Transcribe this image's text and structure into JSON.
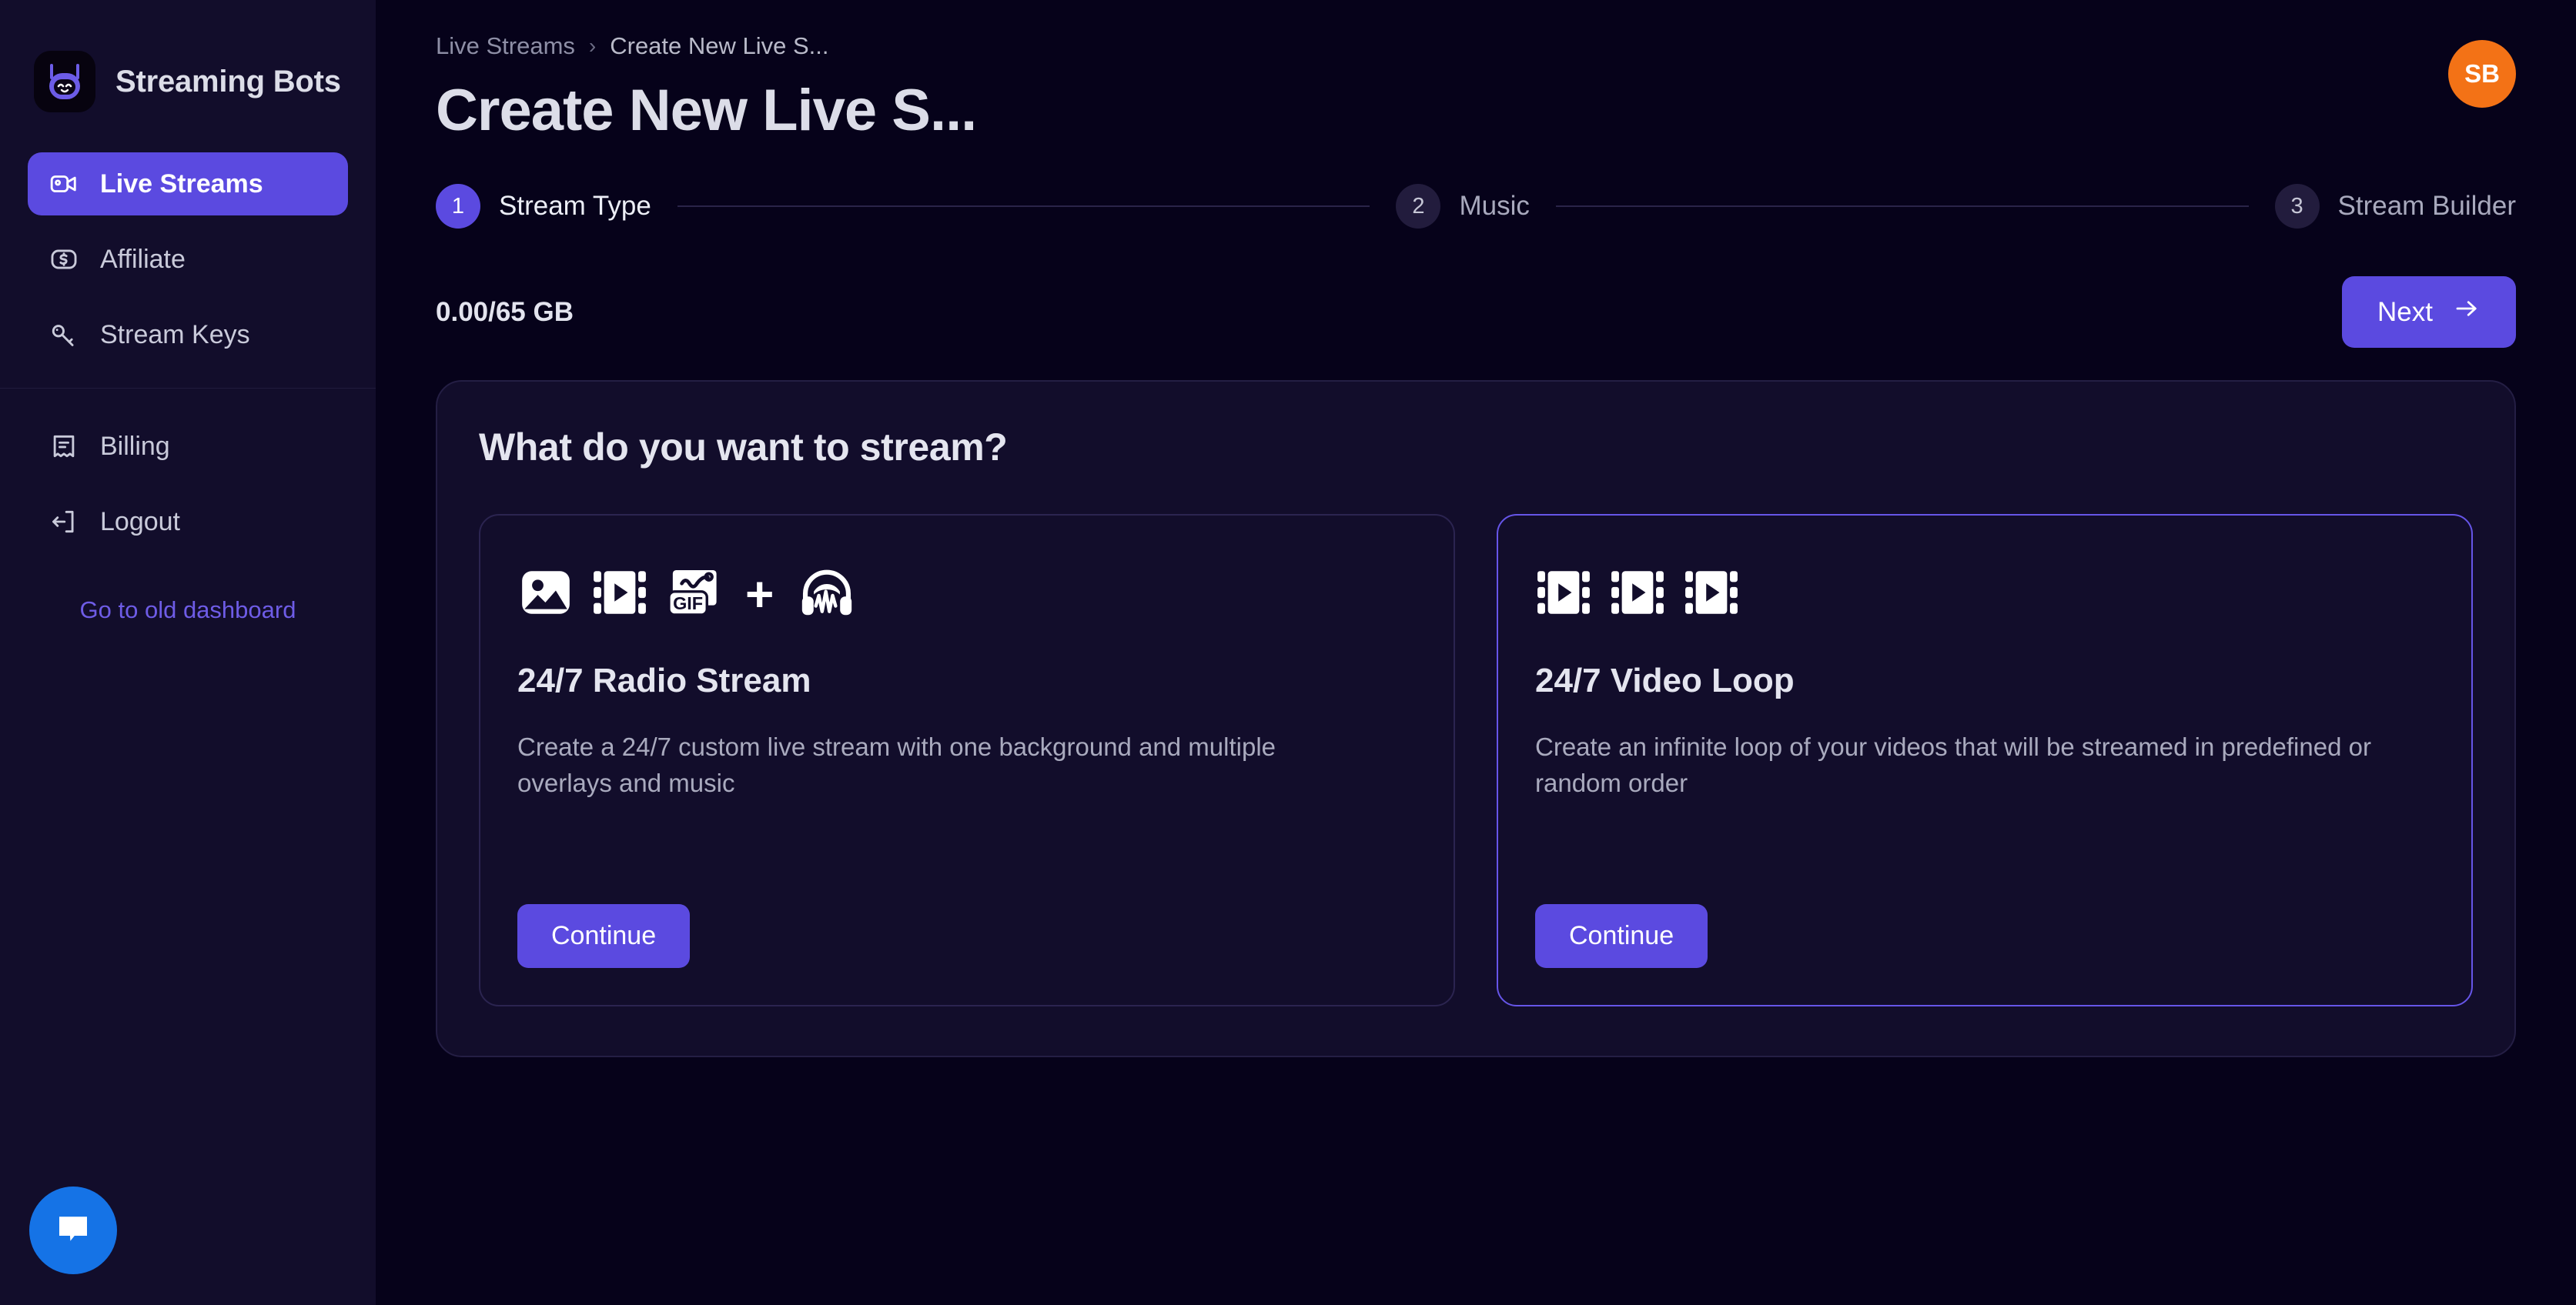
{
  "brand": {
    "name": "Streaming Bots",
    "logo_icon": "bot-logo-icon"
  },
  "sidebar": {
    "primary_items": [
      {
        "label": "Live Streams",
        "icon": "video-camera-icon",
        "active": true
      },
      {
        "label": "Affiliate",
        "icon": "dollar-box-icon",
        "active": false
      },
      {
        "label": "Stream Keys",
        "icon": "key-icon",
        "active": false
      }
    ],
    "secondary_items": [
      {
        "label": "Billing",
        "icon": "receipt-icon",
        "active": false
      },
      {
        "label": "Logout",
        "icon": "logout-arrow-icon",
        "active": false
      }
    ],
    "old_dashboard_link": "Go to old dashboard"
  },
  "header": {
    "breadcrumb": {
      "root": "Live Streams",
      "separator": "›",
      "current": "Create New Live S..."
    },
    "title": "Create New Live S...",
    "avatar_initials": "SB"
  },
  "stepper": {
    "steps": [
      {
        "number": "1",
        "label": "Stream Type",
        "state": "active"
      },
      {
        "number": "2",
        "label": "Music",
        "state": "inactive"
      },
      {
        "number": "3",
        "label": "Stream Builder",
        "state": "inactive"
      }
    ]
  },
  "toolbar": {
    "storage_text": "0.00/65 GB",
    "next_label": "Next",
    "next_icon": "arrow-right-icon"
  },
  "panel": {
    "title": "What do you want to stream?",
    "cards": [
      {
        "id": "radio-stream",
        "title": "24/7 Radio Stream",
        "description": "Create a 24/7 custom live stream with one background and multiple overlays and music",
        "cta_label": "Continue",
        "selected": false,
        "icons": [
          "image-icon",
          "film-icon",
          "gif-icon",
          "plus-icon",
          "headphones-waveform-icon"
        ]
      },
      {
        "id": "video-loop",
        "title": "24/7 Video Loop",
        "description": "Create an infinite loop of your videos that will be streamed in predefined or random order",
        "cta_label": "Continue",
        "selected": true,
        "icons": [
          "film-icon",
          "film-icon",
          "film-icon"
        ]
      }
    ]
  },
  "chat": {
    "icon": "chat-bubble-icon"
  },
  "colors": {
    "accent": "#5b4ae0",
    "accent_border": "#6655e8",
    "page_bg": "#06021a",
    "panel_bg": "#120d2b",
    "avatar_bg": "#f37216",
    "chat_bg": "#1573e6",
    "link": "#6e5ce6"
  }
}
